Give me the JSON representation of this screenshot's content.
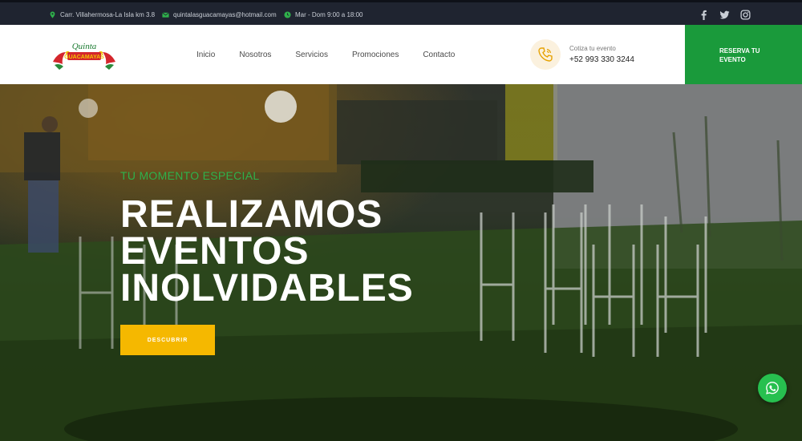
{
  "topbar": {
    "address": "Carr. Villahermosa-La Isla km 3.8",
    "email": "quintalasguacamayas@hotmail.com",
    "hours": "Mar - Dom 9:00 a 18:00",
    "icons": [
      "map-pin-icon",
      "mail-icon",
      "clock-icon"
    ],
    "social": [
      "facebook-icon",
      "twitter-icon",
      "instagram-icon"
    ]
  },
  "header": {
    "logo_text_top": "Quinta",
    "logo_text_bottom": "GUACAMAYAS",
    "nav": [
      "Inicio",
      "Nosotros",
      "Servicios",
      "Promociones",
      "Contacto"
    ],
    "quote_label": "Cotiza tu evento",
    "quote_phone": "+52 993 330 3244",
    "reserve_button": "RESERVA TU EVENTO"
  },
  "hero": {
    "subtitle": "TU MOMENTO ESPECIAL",
    "title_lines": [
      "REALIZAMOS",
      "EVENTOS",
      "INOLVIDABLES"
    ],
    "button": "DESCUBRIR"
  },
  "colors": {
    "topbar_bg": "#1f2430",
    "accent_green": "#1a9a3b",
    "accent_yellow": "#f5b800",
    "whatsapp_green": "#27c04f"
  }
}
